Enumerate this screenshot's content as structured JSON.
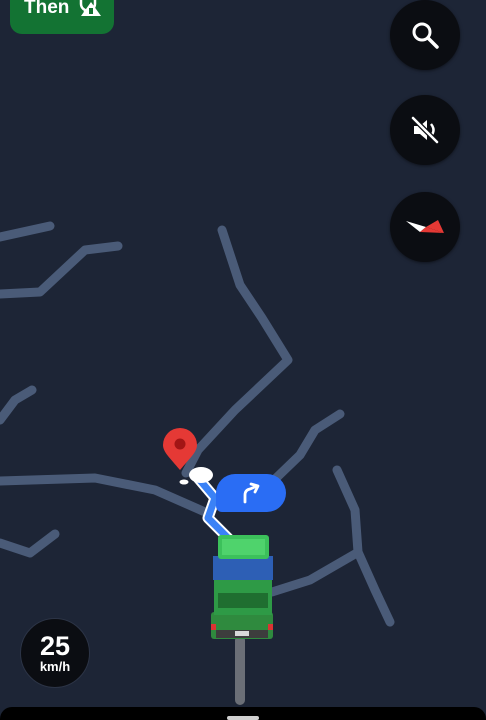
{
  "next_step": {
    "label": "Then",
    "icon": "merge-road-icon",
    "color": "#137333"
  },
  "controls": {
    "search_icon": "search-icon",
    "sound_icon": "volume-off-icon",
    "compass_icon": "compass-icon"
  },
  "speedometer": {
    "value": "25",
    "unit": "km/h"
  },
  "turn_indicator": {
    "icon": "turn-right-icon",
    "color": "#2a6df4"
  },
  "colors": {
    "map_background": "#1d2536",
    "road": "#4a5b78",
    "route": "#3b82f6",
    "destination_pin": "#e53935",
    "vehicle_body": "#2e9a46"
  }
}
